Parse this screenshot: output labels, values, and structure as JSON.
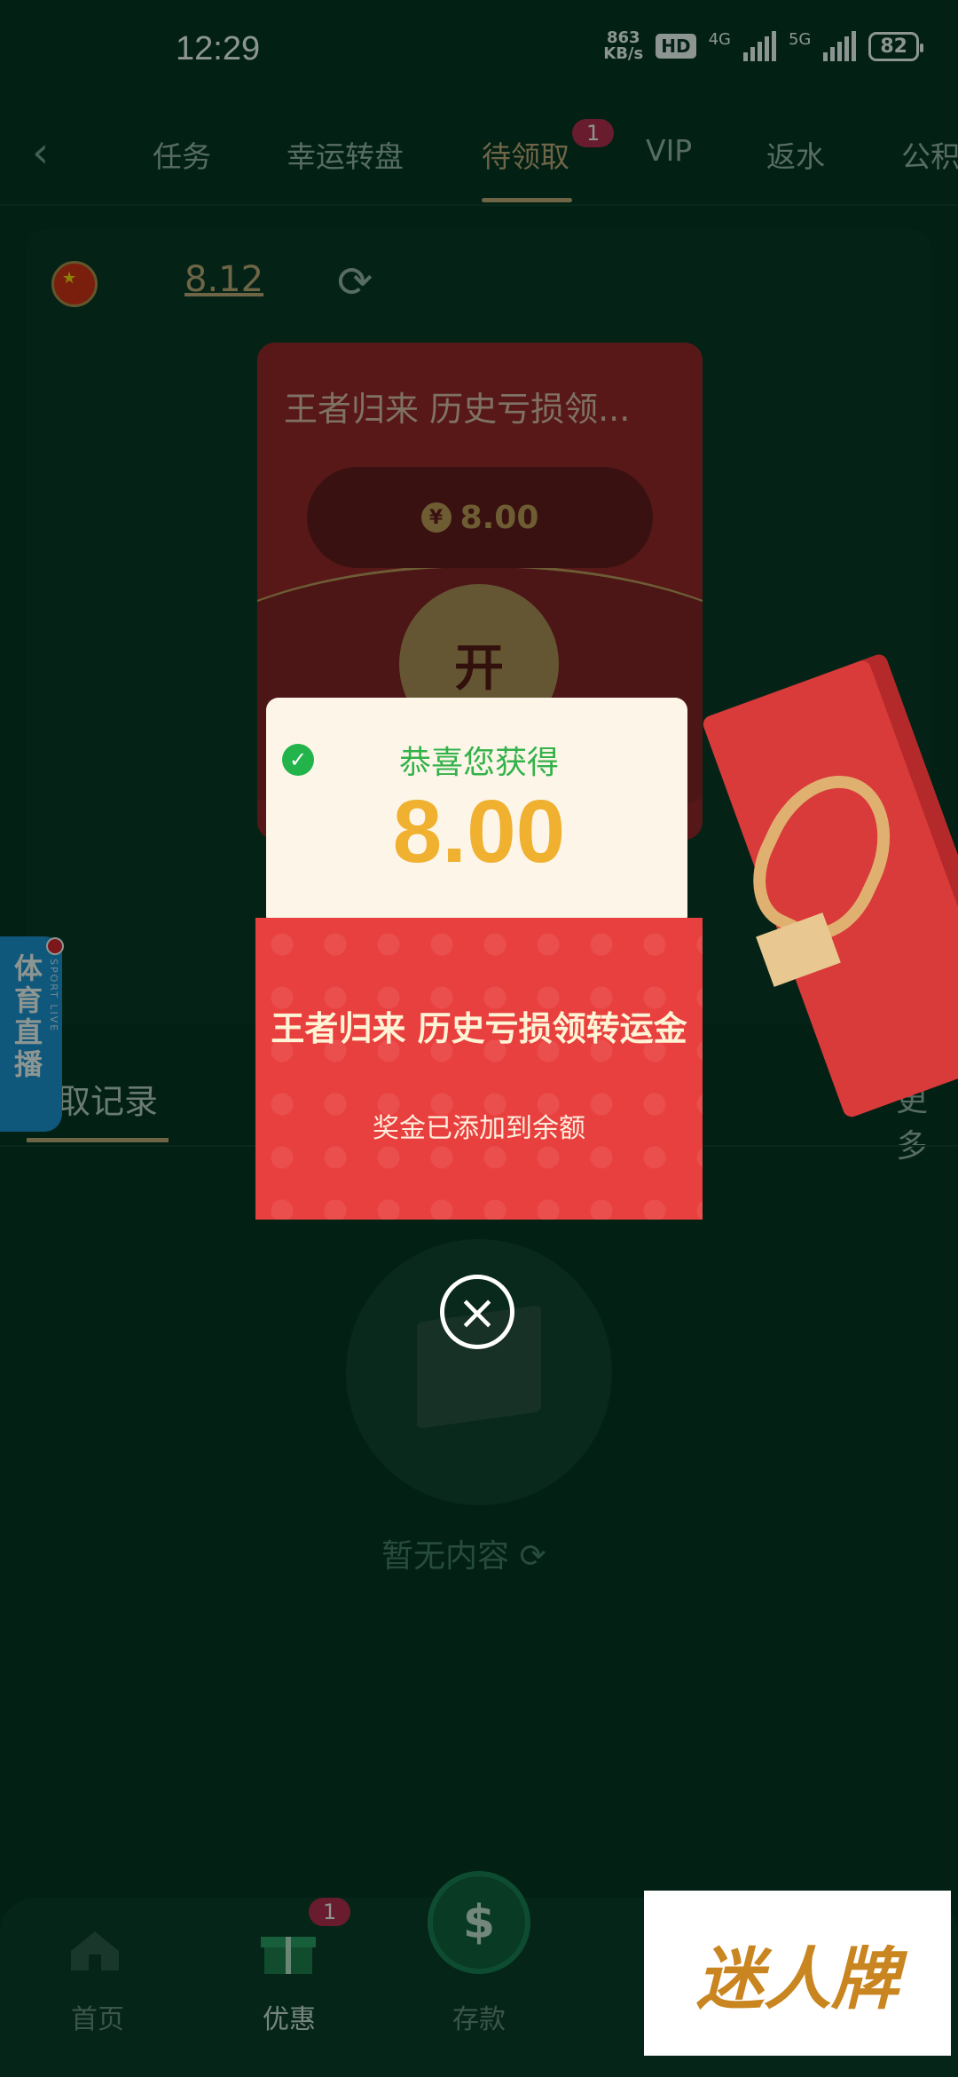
{
  "status_bar": {
    "time": "12:29",
    "net_speed_top": "863",
    "net_speed_bottom": "KB/s",
    "hd": "HD",
    "net1": "4G",
    "net2": "5G",
    "battery": "82"
  },
  "tabs": {
    "items": [
      "任务",
      "幸运转盘",
      "待领取",
      "VIP",
      "返水",
      "公积"
    ],
    "active": "待领取",
    "badge": "1"
  },
  "balance": {
    "amount": "8.12"
  },
  "envelope": {
    "title": "王者归来 历史亏损领...",
    "amount": "8.00",
    "currency_icon": "¥",
    "open_label": "开"
  },
  "reward_popup": {
    "congrats": "恭喜您获得",
    "amount": "8.00",
    "title": "王者归来 历史亏损领转运金",
    "subtitle": "奖金已添加到余额"
  },
  "records": {
    "tab_label": "取记录",
    "more_label": "更多",
    "empty_text": "暂无内容"
  },
  "sport_live": {
    "label_cn": "体育直播",
    "label_en": "SPORT LIVE"
  },
  "bottom_nav": {
    "items": [
      "首页",
      "优惠",
      "存款"
    ],
    "badge": "1"
  },
  "watermark": {
    "text": "迷人牌"
  }
}
